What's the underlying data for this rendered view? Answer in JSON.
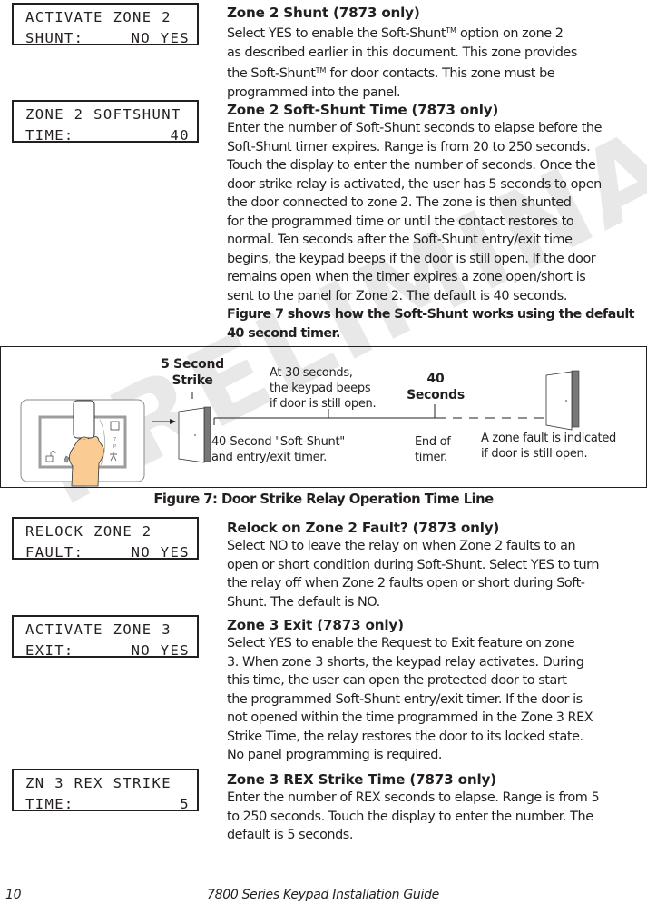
{
  "watermark": "PRELIMINARY",
  "lcd_displays": [
    {
      "line1": "ACTIVATE ZONE 2",
      "line2_label": "SHUNT:",
      "line2_value": "NO YES"
    },
    {
      "line1": "ZONE 2 SOFTSHUNT",
      "line2_label": "TIME:",
      "line2_value": "40"
    },
    {
      "line1": "RELOCK ZONE 2",
      "line2_label": "FAULT:",
      "line2_value": "NO YES"
    },
    {
      "line1": "ACTIVATE ZONE 3",
      "line2_label": "EXIT:",
      "line2_value": "NO YES"
    },
    {
      "line1": "ZN 3 REX STRIKE",
      "line2_label": "TIME:",
      "line2_value": "5"
    }
  ],
  "sections": {
    "zone2_shunt": {
      "title": "Zone 2 Shunt (7873 only)",
      "lines": [
        [
          "Select YES to enable the Soft-Shunt",
          "TM",
          " option on zone 2"
        ],
        [
          "as described earlier in this document. This zone provides"
        ],
        [
          "the Soft-Shunt",
          "TM",
          " for door contacts. This zone must be"
        ],
        [
          "programmed into the panel."
        ]
      ]
    },
    "zone2_softshunt_time": {
      "title": "Zone 2 Soft-Shunt Time  (7873 only)",
      "lines": [
        "Enter the number of Soft-Shunt seconds to elapse before the",
        "Soft-Shunt timer expires.  Range is from 20 to 250 seconds.",
        "Touch the display to enter the number of seconds.  Once the",
        "door strike relay is activated, the user has 5 seconds to open",
        "the door connected to zone 2.  The zone is then shunted",
        "for the programmed time or until the contact restores to",
        "normal.  Ten seconds after the Soft-Shunt entry/exit time",
        "begins, the keypad beeps if the door is still open.  If the door",
        "remains open when the timer expires a zone open/short is",
        "sent to the panel for Zone 2.  The default is 40 seconds."
      ],
      "bold_lines": [
        "Figure 7 shows how the Soft-Shunt works using the default",
        "40 second timer."
      ]
    },
    "relock_zone2": {
      "title": "Relock on Zone 2 Fault?  (7873 only)",
      "lines": [
        "Select NO to leave the relay on when Zone 2 faults to an",
        "open or short condition during Soft-Shunt.  Select YES to turn",
        "the relay off when Zone 2 faults open or short during Soft-",
        "Shunt.  The default is NO."
      ]
    },
    "zone3_exit": {
      "title": "Zone 3 Exit (7873 only)",
      "lines": [
        "Select YES to enable the Request to Exit feature on zone",
        "3. When zone 3 shorts, the keypad relay activates.  During",
        "this time, the user can open the protected door to start",
        "the programmed Soft-Shunt entry/exit timer.  If the door is",
        "not opened within the time programmed in the Zone 3 REX",
        "Strike Time, the relay restores the door to its locked state.",
        "No panel programming is required."
      ]
    },
    "zone3_rex_strike": {
      "title": "Zone 3 REX Strike Time  (7873 only)",
      "lines": [
        "Enter the number of REX seconds to elapse.  Range is from 5",
        "to 250 seconds.  Touch the display to enter the number.  The",
        "default is 5 seconds."
      ]
    }
  },
  "figure": {
    "caption": "Figure 7: Door Strike Relay Operation Time Line",
    "strike_label_1": "5 Second",
    "strike_label_2": "Strike",
    "beep_note": [
      "At 30 seconds,",
      "the keypad beeps",
      "if door is still open."
    ],
    "end_label_1": "40",
    "end_label_2": "Seconds",
    "timer_note": [
      "40-Second \"Soft-Shunt\"",
      "and entry/exit timer."
    ],
    "end_note": [
      "End of",
      "timer."
    ],
    "fault_note": [
      "A zone fault is indicated",
      "if door is still open."
    ],
    "keypad_digits": [
      "7",
      "P"
    ],
    "skin_color": "#fbcb94"
  },
  "footer": {
    "page_number": "10",
    "guide_title": "7800 Series Keypad Installation Guide"
  }
}
